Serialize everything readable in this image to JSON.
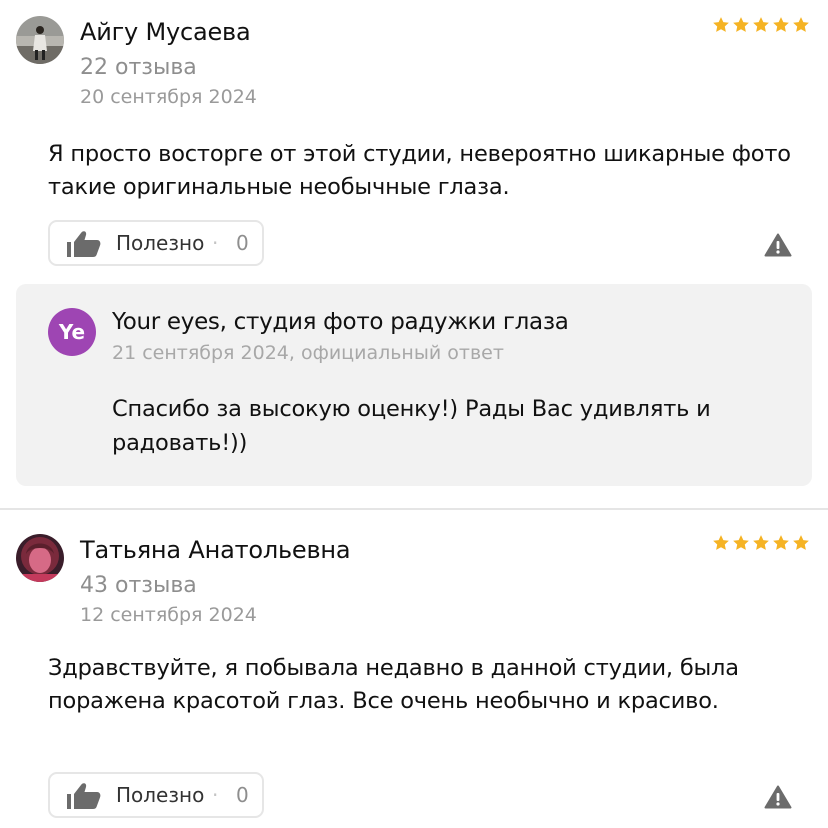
{
  "reviews": [
    {
      "author": "Айгу Мусаева",
      "review_count": "22 отзыва",
      "date": "20 сентября 2024",
      "rating": 5,
      "text": "Я просто восторге от этой студии, невероятно шикарные фото такие оригинальные необычные глаза.",
      "useful_label": "Полезно",
      "useful_separator": "·",
      "useful_count": "0",
      "reply": {
        "logo_text": "Ye",
        "org_name": "Your eyes, студия фото радужки глаза",
        "meta": "21 сентября 2024, официальный ответ",
        "text": "Спасибо за высокую оценку!) Рады Вас удивлять и радовать!))",
        "logo_color": "#9e45b3"
      }
    },
    {
      "author": "Татьяна Анатольевна",
      "review_count": "43 отзыва",
      "date": "12 сентября 2024",
      "rating": 5,
      "text": "Здравствуйте, я побывала недавно в данной студии, была поражена красотой глаз. Все очень необычно и красиво.",
      "useful_label": "Полезно",
      "useful_separator": "·",
      "useful_count": "0"
    }
  ],
  "colors": {
    "star": "#f5b324",
    "reply_background": "#f2f2f2",
    "icon": "#6b6b6b"
  },
  "icons": {
    "rating": "star-icon",
    "useful": "thumbs-up-icon",
    "report": "warning-icon"
  }
}
